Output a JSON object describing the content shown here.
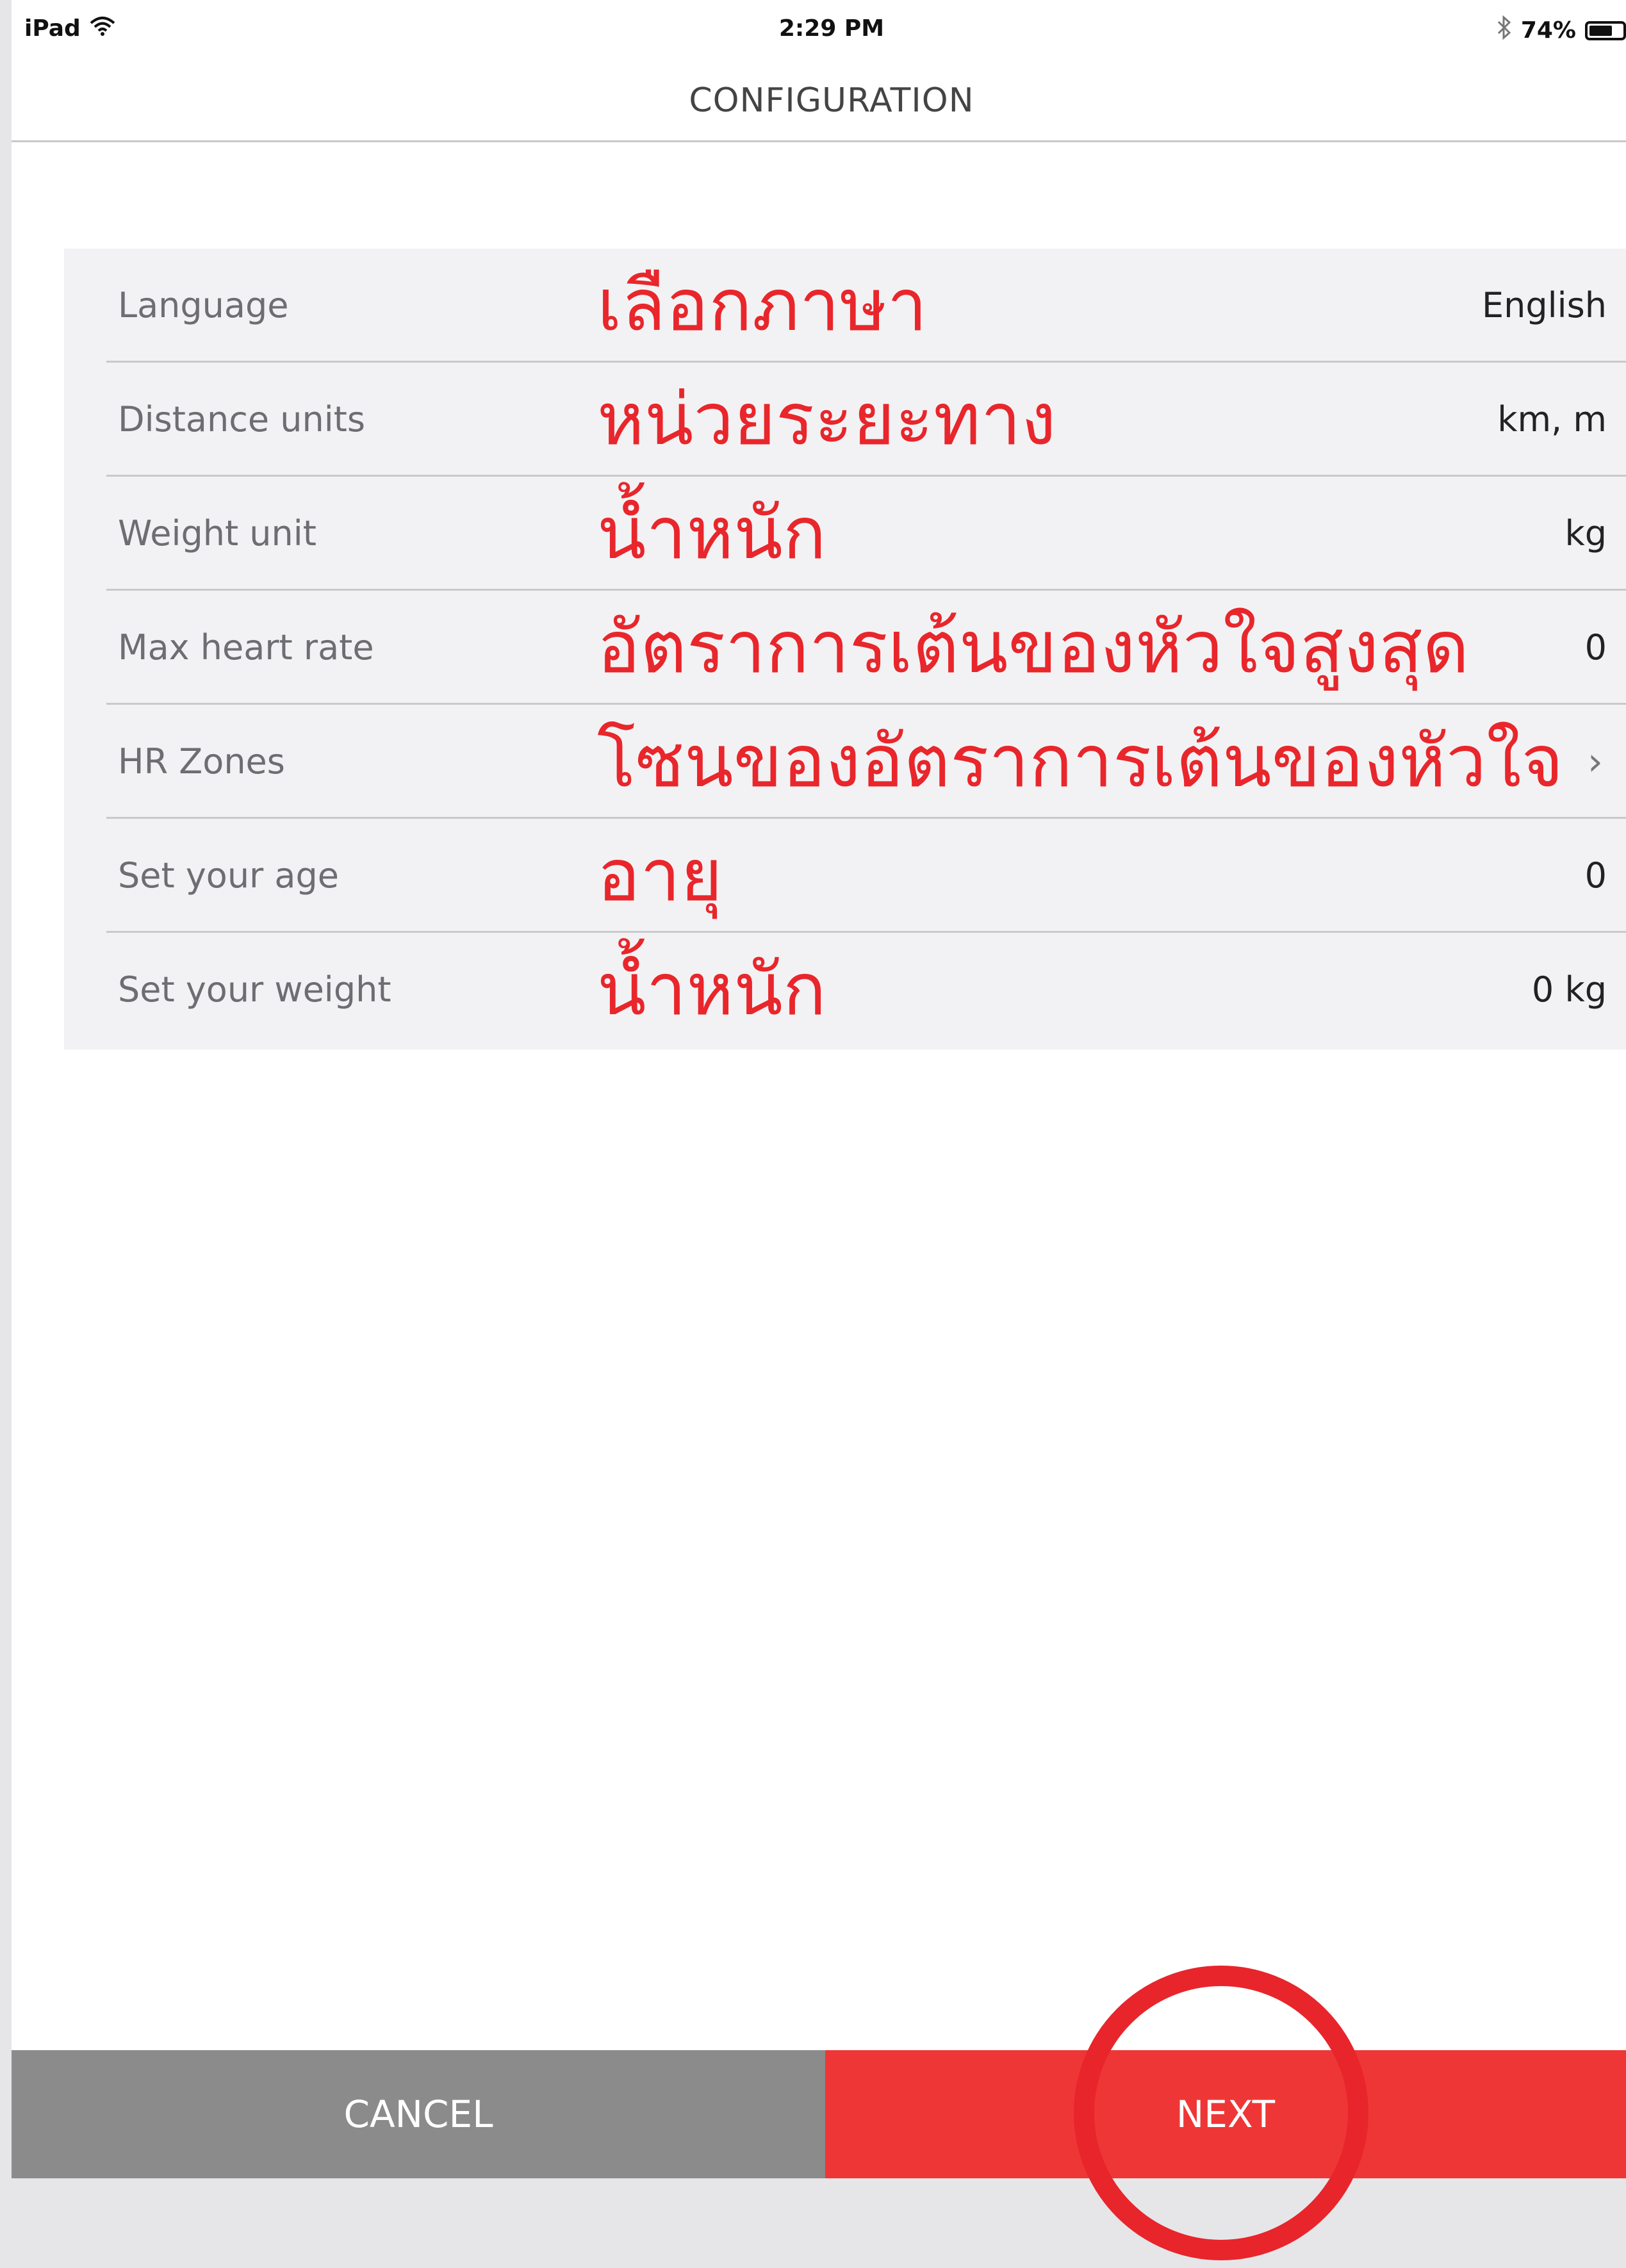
{
  "status_bar": {
    "device": "iPad",
    "time": "2:29 PM",
    "battery": "74%",
    "battery_level": 0.74,
    "icons": [
      "wifi-icon",
      "bluetooth-icon",
      "battery-icon"
    ]
  },
  "header": {
    "title": "CONFIGURATION"
  },
  "settings": {
    "rows": [
      {
        "label": "Language",
        "value": "English",
        "annotation": "เลือกภาษา"
      },
      {
        "label": "Distance units",
        "value": "km, m",
        "annotation": "หน่วยระยะทาง"
      },
      {
        "label": "Weight unit",
        "value": "kg",
        "annotation": "น้ำหนัก"
      },
      {
        "label": "Max heart rate",
        "value": "0",
        "annotation": "อัตราการเต้นของหัวใจสูงสุด"
      },
      {
        "label": "HR Zones",
        "value": "›",
        "annotation": "โซนของอัตราการเต้นของหัวใจ"
      },
      {
        "label": "Set your age",
        "value": "0",
        "annotation": "อายุ"
      },
      {
        "label": "Set your weight",
        "value": "0 kg",
        "annotation": "น้ำหนัก"
      }
    ]
  },
  "footer": {
    "cancel_label": "CANCEL",
    "next_label": "NEXT"
  },
  "colors": {
    "accent": "#ef3636",
    "annotation": "#e8262b",
    "cancel": "#8b8b8b",
    "list_background": "#f2f2f4"
  }
}
